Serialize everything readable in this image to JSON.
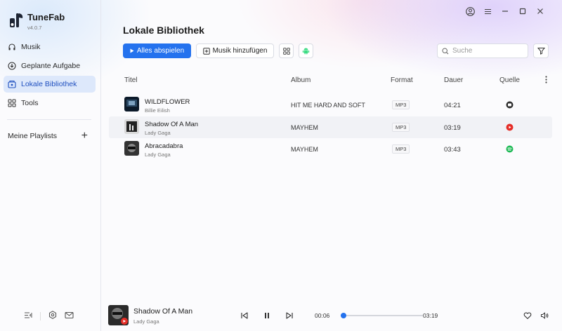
{
  "app": {
    "name": "TuneFab",
    "version": "v4.0.7"
  },
  "sidebar": {
    "items": [
      {
        "label": "Musik",
        "icon": "headphones-icon",
        "active": false
      },
      {
        "label": "Geplante Aufgabe",
        "icon": "clock-download-icon",
        "active": false
      },
      {
        "label": "Lokale Bibliothek",
        "icon": "library-icon",
        "active": true
      },
      {
        "label": "Tools",
        "icon": "grid-icon",
        "active": false
      }
    ],
    "playlists_label": "Meine Playlists",
    "add_label": "+"
  },
  "main": {
    "title": "Lokale Bibliothek",
    "play_all_label": "Alles abspielen",
    "add_music_label": "Musik hinzufügen",
    "search": {
      "placeholder": "Suche",
      "value": ""
    },
    "columns": {
      "title": "Titel",
      "album": "Album",
      "format": "Format",
      "duration": "Dauer",
      "source": "Quelle"
    },
    "tracks": [
      {
        "title": "WILDFLOWER",
        "artist": "Billie Eilish",
        "album": "HIT ME HARD AND SOFT",
        "format": "MP3",
        "duration": "04:21",
        "source": "apple-music-icon"
      },
      {
        "title": "Shadow Of A Man",
        "artist": "Lady Gaga",
        "album": "MAYHEM",
        "format": "MP3",
        "duration": "03:19",
        "source": "youtube-music-icon"
      },
      {
        "title": "Abracadabra",
        "artist": "Lady Gaga",
        "album": "MAYHEM",
        "format": "MP3",
        "duration": "03:43",
        "source": "spotify-icon"
      }
    ]
  },
  "player": {
    "title": "Shadow Of A Man",
    "artist": "Lady Gaga",
    "current_time": "00:06",
    "total_time": "03:19",
    "progress": 0.03
  },
  "colors": {
    "accent": "#2472ee",
    "active_bg": "#dde8fb",
    "spotify": "#1db954",
    "youtube": "#e52d27"
  }
}
